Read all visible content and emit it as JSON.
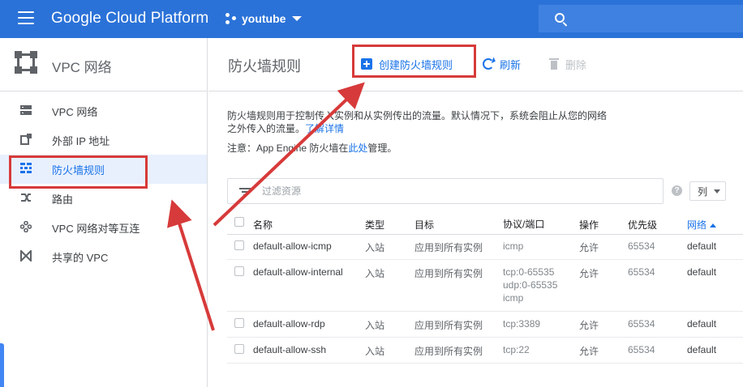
{
  "topbar": {
    "brand": "Google Cloud Platform",
    "project": "youtube"
  },
  "sidebar": {
    "title": "VPC 网络",
    "items": [
      {
        "label": "VPC 网络",
        "icon": "network-icon"
      },
      {
        "label": "外部 IP 地址",
        "icon": "ip-address-icon"
      },
      {
        "label": "防火墙规则",
        "icon": "firewall-icon",
        "active": true
      },
      {
        "label": "路由",
        "icon": "routes-icon"
      },
      {
        "label": "VPC 网络对等互连",
        "icon": "peering-icon"
      },
      {
        "label": "共享的 VPC",
        "icon": "shared-vpc-icon"
      }
    ]
  },
  "main": {
    "title": "防火墙规则",
    "actions": {
      "create": "创建防火墙规则",
      "refresh": "刷新",
      "delete": "删除"
    },
    "description": {
      "text": "防火墙规则用于控制传入实例和从实例传出的流量。默认情况下，系统会阻止从您的网络之外传入的流量。",
      "link": "了解详情"
    },
    "note": {
      "prefix": "注意：App Engine 防火墙在",
      "link": "此处",
      "suffix": "管理。"
    },
    "filter": {
      "placeholder": "过滤资源"
    },
    "columns_button": "列"
  },
  "table": {
    "headers": [
      "名称",
      "类型",
      "目标",
      "协议/端口",
      "操作",
      "优先级",
      "网络"
    ],
    "rows": [
      {
        "name": "default-allow-icmp",
        "type": "入站",
        "target": "应用到所有实例",
        "protocol": [
          "icmp"
        ],
        "action": "允许",
        "priority": "65534",
        "network": "default"
      },
      {
        "name": "default-allow-internal",
        "type": "入站",
        "target": "应用到所有实例",
        "protocol": [
          "tcp:0-65535",
          "udp:0-65535",
          "icmp"
        ],
        "action": "允许",
        "priority": "65534",
        "network": "default"
      },
      {
        "name": "default-allow-rdp",
        "type": "入站",
        "target": "应用到所有实例",
        "protocol": [
          "tcp:3389"
        ],
        "action": "允许",
        "priority": "65534",
        "network": "default"
      },
      {
        "name": "default-allow-ssh",
        "type": "入站",
        "target": "应用到所有实例",
        "protocol": [
          "tcp:22"
        ],
        "action": "允许",
        "priority": "65534",
        "network": "default"
      }
    ]
  },
  "colors": {
    "topbar": "#2b72d8",
    "accent": "#1a73e8",
    "annotation": "#d73a3a"
  }
}
